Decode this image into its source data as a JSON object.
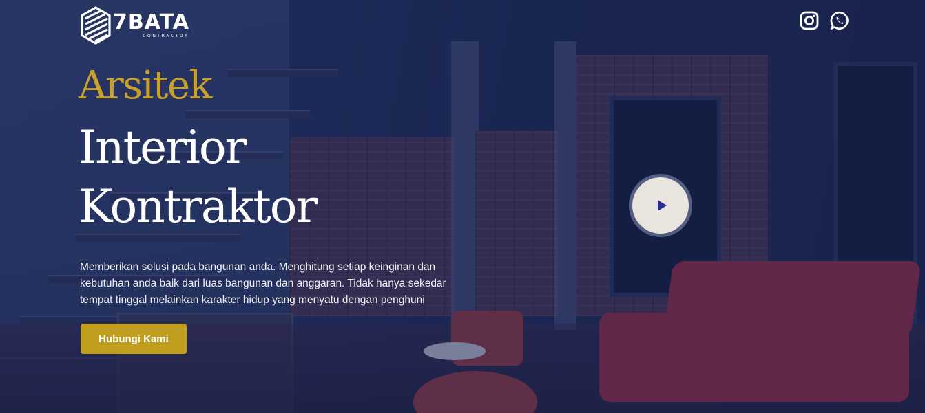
{
  "brand": {
    "name": "7BATA",
    "tagline": "CONTRACTOR"
  },
  "social": {
    "icons": [
      "instagram-icon",
      "whatsapp-icon"
    ]
  },
  "hero": {
    "title_line1": "Arsitek",
    "title_line2": "Interior",
    "title_line3": "Kontraktor",
    "description": "Memberikan solusi pada bangunan anda. Menghitung setiap keinginan dan kebutuhan anda baik dari luas bangunan dan anggaran. Tidak hanya sekedar tempat tinggal melainkan karakter hidup yang menyatu dengan penghuni",
    "cta_label": "Hubungi Kami"
  },
  "colors": {
    "accent_gold": "#c29e1e",
    "overlay_navy": "#1c2850",
    "text_white": "#ffffff"
  }
}
